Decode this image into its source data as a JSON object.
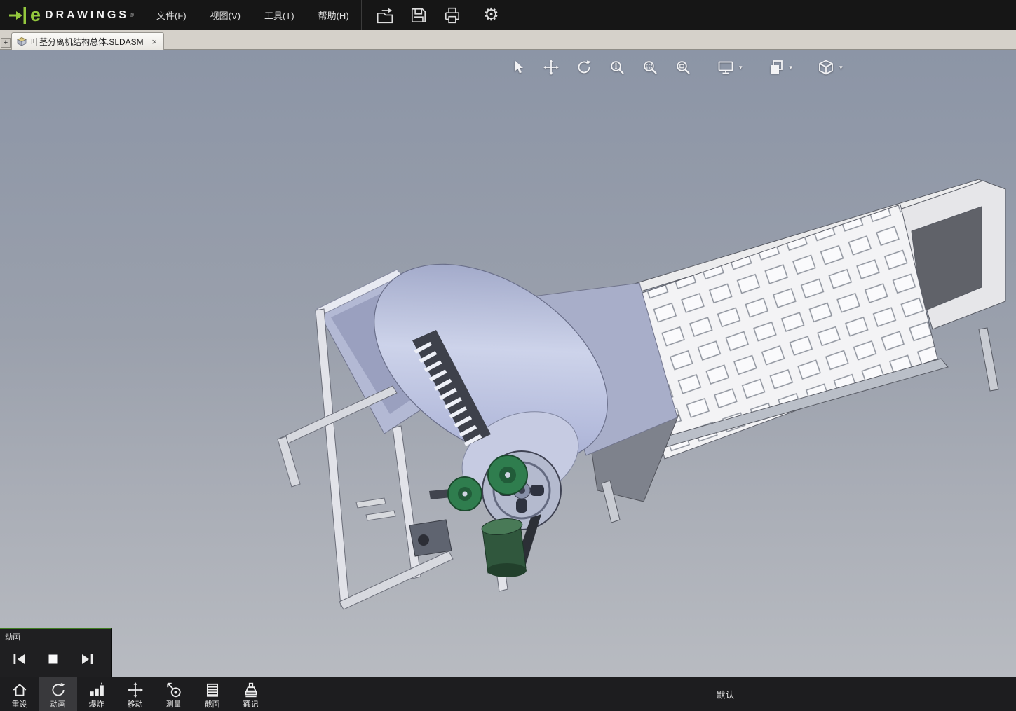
{
  "window": {
    "brand_e": "e",
    "brand_name": "DRAWINGS",
    "brand_reg": "®"
  },
  "glyphs": {
    "caret": "▾"
  },
  "menu_bar": {
    "items": [
      {
        "label": "文件(F)"
      },
      {
        "label": "视图(V)"
      },
      {
        "label": "工具(T)"
      },
      {
        "label": "帮助(H)"
      }
    ]
  },
  "quick_toolbar": {
    "icons": [
      {
        "name": "open-icon"
      },
      {
        "name": "save-icon"
      },
      {
        "name": "print-icon"
      },
      {
        "name": "options-gear-icon"
      }
    ]
  },
  "tab_bar": {
    "new_tab_label": "+",
    "tabs": [
      {
        "label": "叶茎分离机结构总体.SLDASM",
        "close_label": "×",
        "active": true
      }
    ]
  },
  "view_toolbar": {
    "icons": [
      {
        "name": "select-tool-icon"
      },
      {
        "name": "pan-tool-icon"
      },
      {
        "name": "rotate-tool-icon"
      },
      {
        "name": "zoom-tool-icon"
      },
      {
        "name": "zoom-area-tool-icon"
      },
      {
        "name": "zoom-fit-tool-icon"
      },
      {
        "name": "fullscreen-monitor-icon",
        "has_dropdown": true
      },
      {
        "name": "display-style-icon",
        "has_dropdown": true
      },
      {
        "name": "standard-views-cube-icon",
        "has_dropdown": true
      }
    ]
  },
  "animation_panel": {
    "title": "动画",
    "buttons": [
      {
        "name": "skip-to-start-button"
      },
      {
        "name": "stop-button"
      },
      {
        "name": "skip-to-end-button"
      }
    ]
  },
  "bottom_toolbar": {
    "items": [
      {
        "label": "重设"
      },
      {
        "label": "动画",
        "active": true
      },
      {
        "label": "爆炸"
      },
      {
        "label": "移动"
      },
      {
        "label": "测量"
      },
      {
        "label": "截面"
      },
      {
        "label": "戳记"
      }
    ],
    "configuration": "默认"
  },
  "model": {
    "file_name": "叶茎分离机结构总体.SLDASM"
  },
  "colors": {
    "brand_green": "#94c83d",
    "topbar_bg": "#161616",
    "tabbar_bg": "#d5d1ca",
    "viewport_top": "#8c95a6",
    "viewport_bottom": "#b8bbc1",
    "bottombar_bg": "#1d1d1f",
    "drum_lavender": "#b3badb",
    "pulley_green": "#2f7d4e"
  }
}
